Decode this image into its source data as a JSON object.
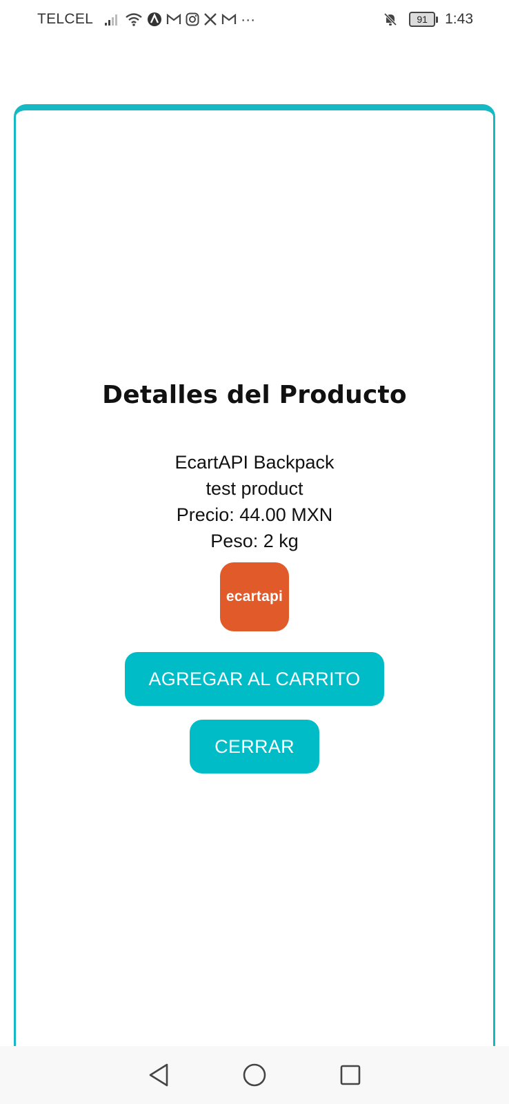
{
  "status_bar": {
    "carrier": "TELCEL",
    "battery": "91",
    "time": "1:43",
    "icons": [
      "signal-icon",
      "wifi-icon",
      "arc-app-icon",
      "gmail-icon",
      "instagram-icon",
      "x-icon",
      "gmail-icon",
      "more-notifications-icon",
      "do-not-disturb-icon",
      "battery-icon"
    ],
    "more_glyph": "···"
  },
  "dialog": {
    "title": "Detalles del Producto",
    "product_name": "EcartAPI Backpack",
    "description": "test product",
    "price": "Precio: 44.00 MXN",
    "weight": "Peso: 2 kg",
    "logo_text": "ecartapi",
    "add_button": "AGREGAR AL CARRITO",
    "close_button": "CERRAR"
  },
  "colors": {
    "accent": "#00bcc7",
    "card_border": "#16b8c4",
    "logo_bg": "#e15a2a"
  },
  "nav_bar": {
    "icons": [
      "back-icon",
      "home-icon",
      "recents-icon"
    ]
  }
}
